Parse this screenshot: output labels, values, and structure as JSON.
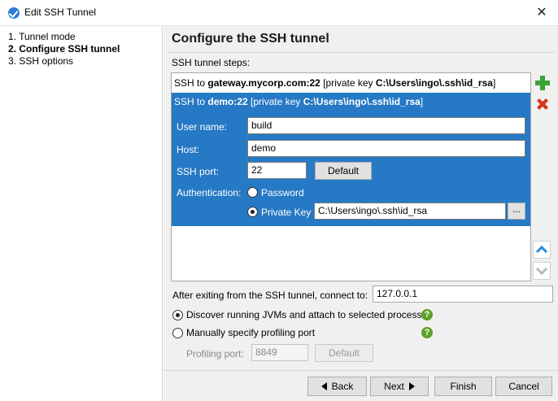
{
  "window": {
    "title": "Edit SSH Tunnel",
    "close_glyph": "✕"
  },
  "nav": {
    "items": [
      {
        "label": "1. Tunnel mode",
        "active": false
      },
      {
        "label": "2. Configure SSH tunnel",
        "active": true
      },
      {
        "label": "3. SSH options",
        "active": false
      }
    ]
  },
  "page": {
    "title": "Configure the SSH tunnel",
    "steps_label": "SSH tunnel steps:"
  },
  "steps": [
    {
      "prefix": "SSH to ",
      "host": "gateway.mycorp.com:22",
      "mid": " [private key ",
      "key": "C:\\Users\\ingo\\.ssh\\id_rsa",
      "suffix": "]"
    },
    {
      "prefix": "SSH to ",
      "host": "demo:22",
      "mid": " [private key ",
      "key": "C:\\Users\\ingo\\.ssh\\id_rsa",
      "suffix": "]"
    }
  ],
  "editor": {
    "user_label": "User name:",
    "user_value": "build",
    "host_label": "Host:",
    "host_value": "demo",
    "port_label": "SSH port:",
    "port_value": "22",
    "default_label": "Default",
    "auth_label": "Authentication:",
    "password_label": "Password",
    "privkey_label": "Private Key",
    "privkey_value": "C:\\Users\\ingo\\.ssh\\id_rsa",
    "browse_label": "..."
  },
  "after": {
    "label": "After exiting from the SSH tunnel, connect to:",
    "value": "127.0.0.1"
  },
  "options": {
    "discover_label": "Discover running JVMs and attach to selected process",
    "manual_label": "Manually specify profiling port",
    "port_label": "Profiling port:",
    "port_value": "8849",
    "default_label": "Default",
    "help_glyph": "?"
  },
  "footer": {
    "back": "Back",
    "next": "Next",
    "finish": "Finish",
    "cancel": "Cancel"
  },
  "colors": {
    "selection": "#2679c4",
    "add": "#3aa335",
    "remove": "#d6361c",
    "arrow": "#2b8ad8",
    "help": "#5ca028"
  }
}
